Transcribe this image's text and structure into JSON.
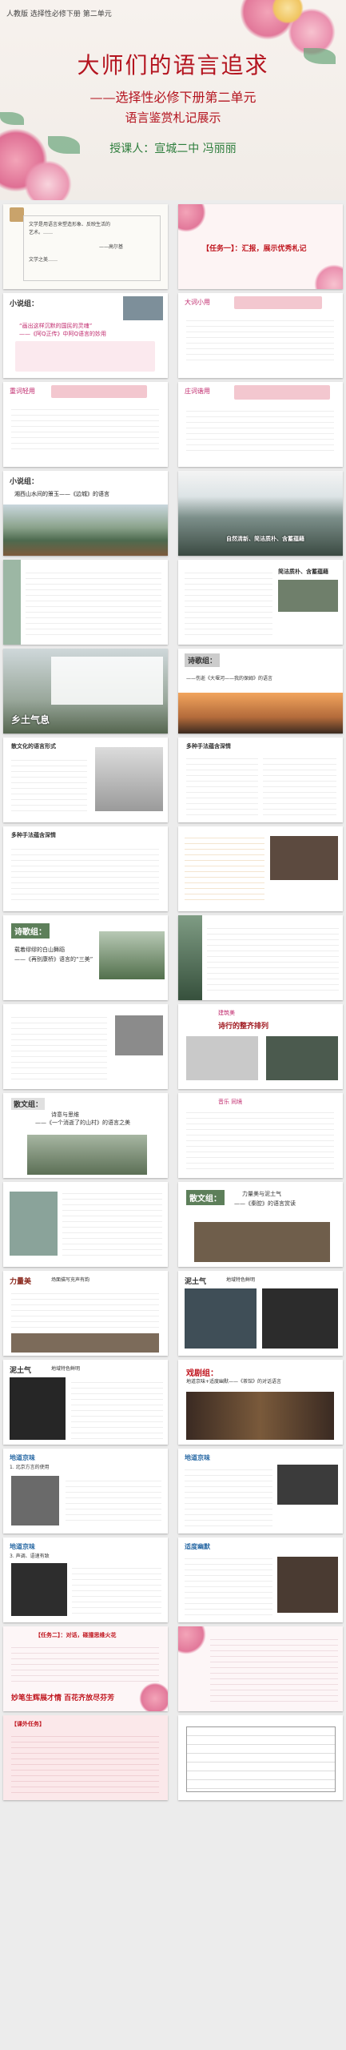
{
  "cover": {
    "badge": "人教版  选择性必修下册  第二单元",
    "title": "大师们的语言追求",
    "subtitle": "——选择性必修下册第二单元",
    "subtitle2": "语言鉴赏札记展示",
    "author": "授课人：宣城二中    冯丽丽"
  },
  "slides": [
    {
      "id": "s1",
      "h": "",
      "lines": [
        "文学是用语言来塑造形象、反映生活的",
        "艺术。……",
        "——高尔基",
        "文学之美……"
      ]
    },
    {
      "id": "s2",
      "h": "【任务一】：汇报，展示优秀札记",
      "lines": []
    },
    {
      "id": "s3",
      "h": "小说组：",
      "lines": [
        "“画出这样沉默的国民的灵魂”",
        "——《阿Q正传》中阿Q语言的妙用"
      ]
    },
    {
      "id": "s4",
      "h": "大词小用",
      "lines": [
        "精彩批注……"
      ]
    },
    {
      "id": "s5",
      "h": "重词轻用",
      "lines": []
    },
    {
      "id": "s6",
      "h": "庄词谐用",
      "lines": []
    },
    {
      "id": "s7",
      "h": "小说组：",
      "lines": [
        "湘西山水间的箫玉——《边城》的语言"
      ]
    },
    {
      "id": "s8",
      "h": "",
      "lines": [
        "自然清新、简洁质朴、含蓄蕴藉"
      ]
    },
    {
      "id": "s9",
      "h": "",
      "lines": []
    },
    {
      "id": "s10",
      "h": "简洁质朴、含蓄蕴藉",
      "lines": []
    },
    {
      "id": "s11",
      "h": "乡土气息",
      "lines": []
    },
    {
      "id": "s12",
      "h": "诗歌组：",
      "lines": [
        "——伤逝《大堰河——我的保姆》的语言"
      ]
    },
    {
      "id": "s13",
      "h": "散文化的语言形式",
      "lines": []
    },
    {
      "id": "s14",
      "h": "多种手法蕴含深情",
      "lines": []
    },
    {
      "id": "s15",
      "h": "多种手法蕴含深情",
      "lines": []
    },
    {
      "id": "s16",
      "h": "",
      "lines": []
    },
    {
      "id": "s17",
      "h": "诗歌组：",
      "lines": [
        "载着缪缪的白山舞蹈",
        "——《再别康桥》语言的“三美”"
      ]
    },
    {
      "id": "s18",
      "h": "",
      "lines": []
    },
    {
      "id": "s19",
      "h": "",
      "lines": []
    },
    {
      "id": "s20",
      "h": "诗行的整齐排列",
      "lines": [
        "建筑美"
      ]
    },
    {
      "id": "s21",
      "h": "散文组：",
      "lines": [
        "诗意与思维",
        "——《一个消逝了的山村》的语言之美"
      ]
    },
    {
      "id": "s22",
      "h": "音乐 同境",
      "lines": []
    },
    {
      "id": "s23",
      "h": "",
      "lines": []
    },
    {
      "id": "s24",
      "h": "散文组：",
      "lines": [
        "力量美与泥土气",
        "——《秦腔》的语言赏读"
      ]
    },
    {
      "id": "s25",
      "h": "力量美",
      "lines": [
        "场面描写充声有韵"
      ]
    },
    {
      "id": "s26",
      "h": "泥土气",
      "lines": [
        "地域特色鲜明"
      ]
    },
    {
      "id": "s27",
      "h": "泥土气",
      "lines": [
        "地域特色鲜明"
      ]
    },
    {
      "id": "s28",
      "h": "戏剧组：",
      "lines": [
        "地道京味+适度幽默——《茶馆》的对话语言"
      ]
    },
    {
      "id": "s29",
      "h": "地道京味",
      "lines": [
        "1. 北京方言的使用"
      ]
    },
    {
      "id": "s30",
      "h": "地道京味",
      "lines": [
        "2. 人物身份……"
      ]
    },
    {
      "id": "s31",
      "h": "地道京味",
      "lines": [
        "3. 声调、语速有致"
      ]
    },
    {
      "id": "s32",
      "h": "适度幽默",
      "lines": []
    },
    {
      "id": "s33",
      "h": "【任务二】：对话，碰撞思维火花",
      "lines": [
        "妙笔生辉展才情  百花齐放尽芬芳"
      ]
    },
    {
      "id": "s34",
      "h": "",
      "lines": [
        "……"
      ]
    },
    {
      "id": "s35",
      "h": "【课外任务】",
      "lines": []
    },
    {
      "id": "s36",
      "h": "",
      "lines": []
    }
  ]
}
